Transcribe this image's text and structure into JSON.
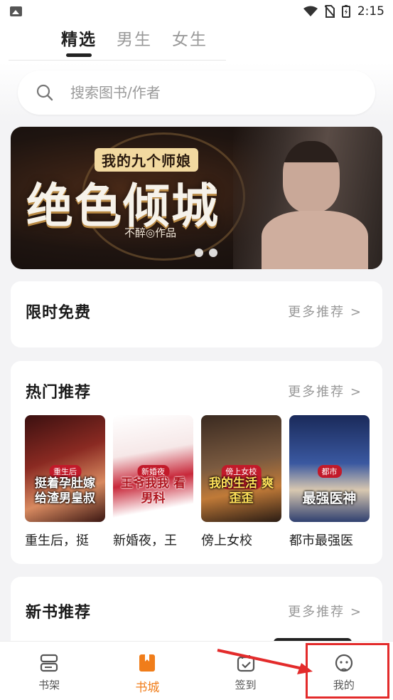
{
  "status_bar": {
    "time": "2:15"
  },
  "header": {
    "tabs": [
      {
        "label": "精选",
        "active": true
      },
      {
        "label": "男生",
        "active": false
      },
      {
        "label": "女生",
        "active": false
      }
    ]
  },
  "search": {
    "placeholder": "搜索图书/作者",
    "icon": "search-icon"
  },
  "banner": {
    "subtitle": "我的九个师娘",
    "title": "绝色倾城",
    "author_line": "不醉◎作品",
    "dots": 2
  },
  "sections": {
    "free": {
      "title": "限时免费",
      "more": "更多推荐 >"
    },
    "hot": {
      "title": "热门推荐",
      "more": "更多推荐 >",
      "books": [
        {
          "name": "重生后，挺",
          "cover_text": "挺着孕肚嫁 给渣男皇叔",
          "tag": "重生后"
        },
        {
          "name": "新婚夜，王",
          "cover_text": "王爷我我 看男科",
          "tag": "新婚夜"
        },
        {
          "name": "傍上女校",
          "cover_text": "我的生活 爽歪歪",
          "tag": "傍上女校花"
        },
        {
          "name": "都市最强医",
          "cover_text": "最强医神",
          "tag": "都市"
        }
      ]
    },
    "new": {
      "title": "新书推荐",
      "more": "更多推荐 >"
    }
  },
  "bottom_nav": [
    {
      "label": "书架",
      "icon": "bookshelf-icon",
      "active": false
    },
    {
      "label": "书城",
      "icon": "bookstore-icon",
      "active": true
    },
    {
      "label": "签到",
      "icon": "checkin-icon",
      "active": false
    },
    {
      "label": "我的",
      "icon": "profile-icon",
      "active": false
    }
  ],
  "colors": {
    "accent": "#f07d1a",
    "annotation": "#e32b2b"
  }
}
